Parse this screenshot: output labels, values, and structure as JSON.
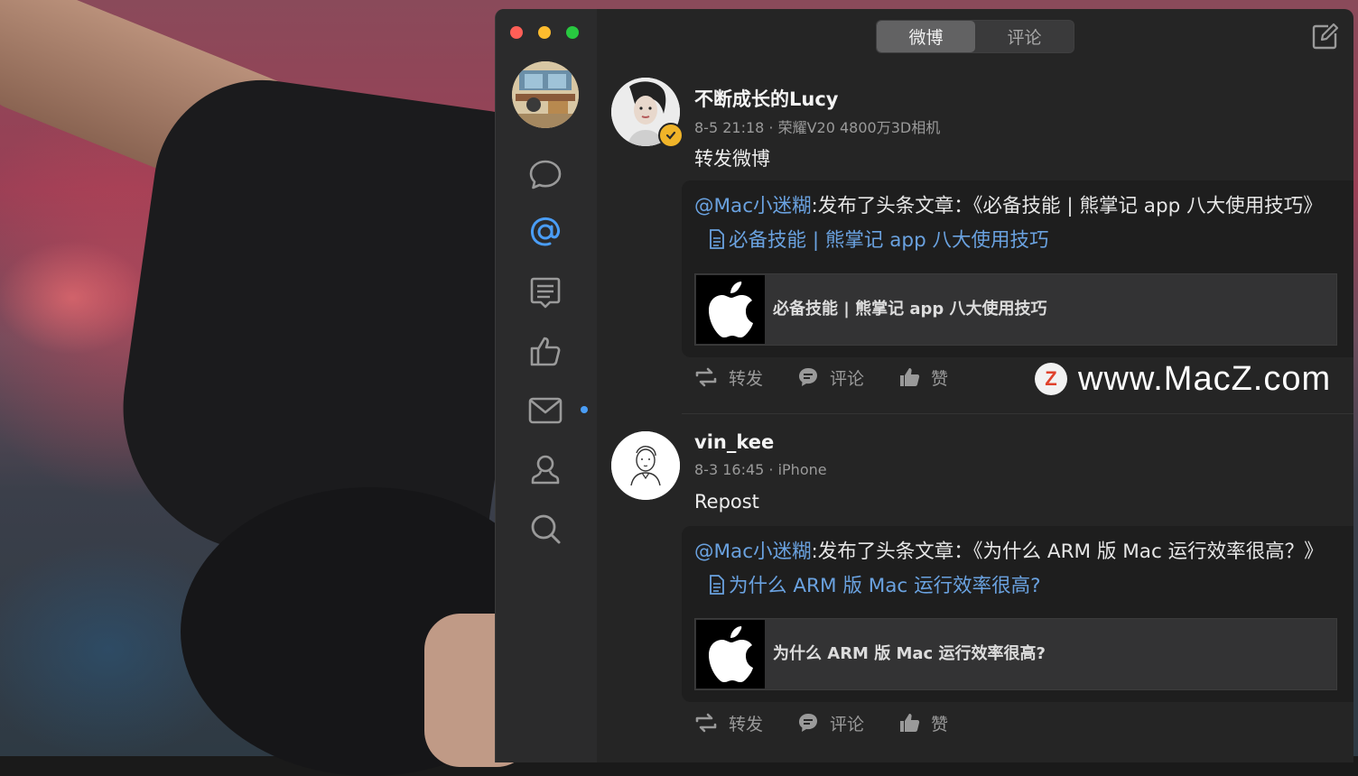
{
  "window": {
    "tabs": [
      {
        "label": "微博",
        "active": true
      },
      {
        "label": "评论",
        "active": false
      }
    ]
  },
  "sidebar": {
    "items": [
      {
        "icon": "chat-bubble-icon"
      },
      {
        "icon": "at-sign-icon",
        "active": true
      },
      {
        "icon": "message-list-icon"
      },
      {
        "icon": "thumbs-up-icon"
      },
      {
        "icon": "mail-icon",
        "unread": true
      },
      {
        "icon": "profile-icon"
      },
      {
        "icon": "search-icon"
      }
    ],
    "accent": "#4a9df6"
  },
  "posts": [
    {
      "author": "不断成长的Lucy",
      "meta": "8-5 21:18 · 荣耀V20 4800万3D相机",
      "verified": true,
      "text": "转发微博",
      "repost": {
        "mention": "@Mac小迷糊",
        "body": ":发布了头条文章：《必备技能 | 熊掌记 app 八大使用技巧》",
        "link_title": "必备技能 | 熊掌记 app 八大使用技巧",
        "card_title": "必备技能 | 熊掌记 app 八大使用技巧"
      },
      "actions": {
        "repost": "转发",
        "comment": "评论",
        "like": "赞"
      }
    },
    {
      "author": "vin_kee",
      "meta": "8-3 16:45 · iPhone",
      "verified": false,
      "text": "Repost",
      "repost": {
        "mention": "@Mac小迷糊",
        "body": ":发布了头条文章：《为什么 ARM 版 Mac 运行效率很高？》",
        "link_title": "为什么 ARM 版 Mac 运行效率很高?",
        "card_title": "为什么 ARM 版 Mac 运行效率很高?"
      },
      "actions": {
        "repost": "转发",
        "comment": "评论",
        "like": "赞"
      }
    }
  ],
  "watermark": {
    "logo": "Z",
    "text": "www.MacZ.com"
  }
}
